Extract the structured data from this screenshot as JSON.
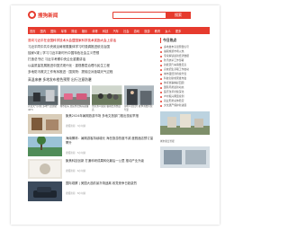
{
  "header": {
    "logo_text": "搜狗新闻",
    "search_placeholder": "",
    "search_button": "搜索"
  },
  "nav": [
    "首页",
    "国内",
    "国际",
    "军事",
    "财经",
    "娱乐",
    "体育",
    "科技",
    "汽车",
    "社会",
    "游戏",
    "旅游",
    "教育",
    "女人",
    "更多"
  ],
  "headlines": [
    {
      "text": "习近平在全国科学技术大会暨国家科学技术奖励大会上讲话",
      "tag": "要闻",
      "red": true
    },
    {
      "text": "习近平同中共中央政治局常委集体学习时强调推进依法治国",
      "tag": "",
      "red": false
    },
    {
      "text": "独家V观 | 学习习近平新时代中国特色社会主义思想",
      "tag": "",
      "red": false
    },
    {
      "text": "打造总书记 习近平考察中央企业重要讲话",
      "tag": "",
      "red": false
    },
    {
      "text": "以高质量发展推进中国式现代化 · 重视基层治理与民生工程",
      "tag": "",
      "red": false
    },
    {
      "text": "多地防汛救灾工作有序推进 · 国务院：提前应对极端天气过程",
      "tag": "",
      "red": false
    }
  ],
  "section_title": "高温来袭 多地发布橙色预警 出行注意防暑",
  "photo_row": [
    {
      "caption": "高温天气持续 多地气温突破40℃"
    },
    {
      "caption": "城市街头 居民外出纳凉避暑"
    },
    {
      "caption": "景区游人如织 暑期出游热度高"
    },
    {
      "caption": "商场人流回升 夏季消费持续升温"
    }
  ],
  "cards": [
    {
      "title": "聚焦2024年暑期旅游市场 多地文旅部门推出惠民举措",
      "meta": "搜狐新闻 · 3小时前"
    },
    {
      "title": "海南椰林：暑期游客持续增长 海岛旅游热度不减 度假酒店预订量攀升",
      "meta": "搜狐新闻 · 5小时前"
    },
    {
      "title": "聚焦科技创新 打通科研成果转化最后一公里 推动产业升级",
      "meta": "搜狐新闻 · 6小时前"
    },
    {
      "title": "国际观察 | 美国大选前景扑朔迷离 政党竞争日趋激烈",
      "meta": "搜狐新闻 · 8小时前"
    }
  ],
  "sidebar": {
    "title": "今日热点",
    "items": [
      "多地发布高温预警信号",
      "暑期旅游市场火热",
      "专家解读最新经济数据",
      "防汛抗旱工作部署",
      "新能源汽车销量走高",
      "高校招生录取工作启动",
      "城市夜经济持续升温",
      "科技创新成果发布会",
      "体育赛事精彩回顾",
      "国际局势最新动态",
      "医疗改革持续深化",
      "乡村振兴典型案例",
      "就业形势总体稳定",
      "文化遗产保护新进展"
    ],
    "image_caption": "城市夏日景观"
  },
  "colors": {
    "accent": "#e63b2e"
  }
}
